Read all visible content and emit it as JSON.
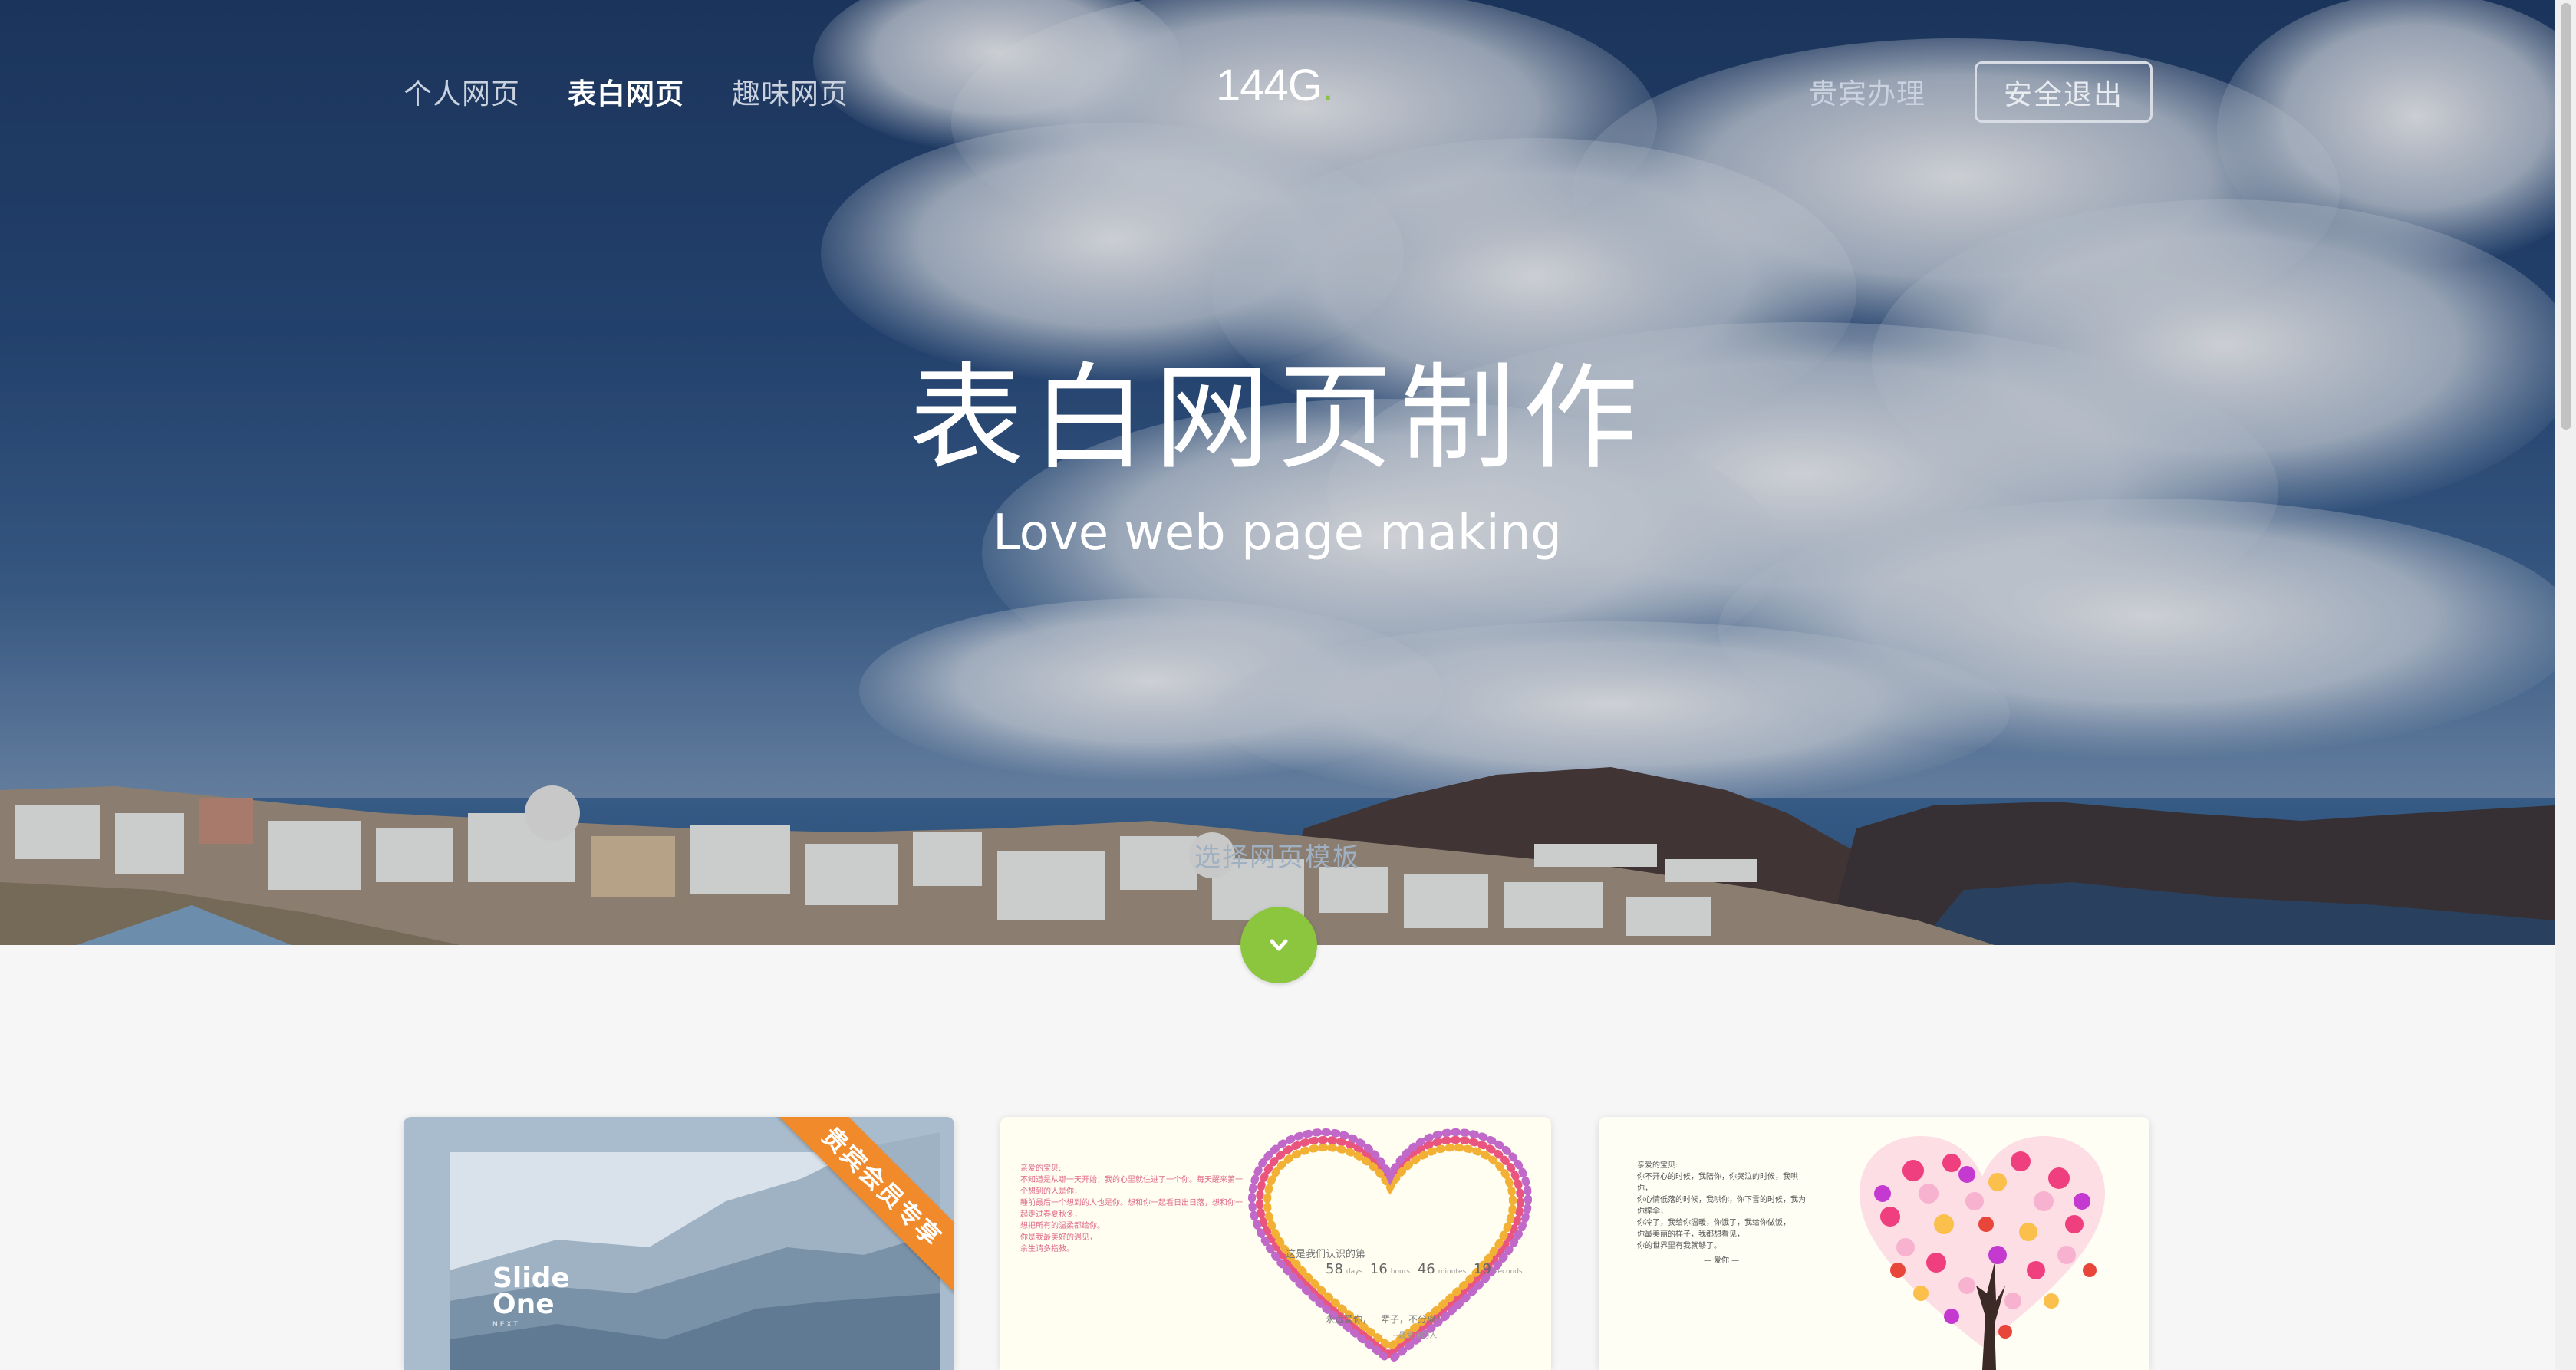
{
  "nav": {
    "left_items": [
      "个人网页",
      "表白网页",
      "趣味网页"
    ],
    "active_index": 1,
    "logo_text": "144G",
    "logo_dot": ".",
    "vip_label": "贵宾办理",
    "logout_label": "安全退出"
  },
  "hero": {
    "title": "表白网页制作",
    "subtitle": "Love web page making",
    "choose_label": "选择网页模板"
  },
  "icons": {
    "down_button": "chevron-down-icon"
  },
  "colors": {
    "accent": "#8cc63f",
    "ribbon": "#f08a2a",
    "nav_active": "#ffffff",
    "nav_inactive": "#c9d2de"
  },
  "cards": [
    {
      "ribbon": "贵宾会员专享",
      "slide_title_line1": "Slide",
      "slide_title_line2": "One",
      "slide_sub": "NEXT"
    },
    {
      "text_lines": [
        "亲爱的宝贝:",
        "不知道是从哪一天开始，我的心里就住进了一个你。每天醒来第一个想到的人是你，",
        "睡前最后一个想到的人也是你。想和你一起看日出日落，想和你一起走过春夏秋冬，",
        "想把所有的温柔都给你。",
        "你是我最美好的遇见，",
        "余生请多指教。"
      ],
      "count_label": "这是我们认识的第",
      "counter_days": "58",
      "counter_hours": "16",
      "counter_minutes": "46",
      "counter_seconds": "19",
      "label_days": "days",
      "label_hours": "hours",
      "label_minutes": "minutes",
      "label_seconds": "seconds",
      "bottom_line": "永远爱你，一辈子，不分离！",
      "signature": "--最爱你的人"
    },
    {
      "text_lines": [
        "亲爱的宝贝:",
        "你不开心的时候，我陪你，你哭泣的时候，我哄你，",
        "你心情低落的时候，我哄你，你下雪的时候，我为你撑伞，",
        "你冷了，我给你温暖，你饿了，我给你做饭，",
        "你最美丽的样子，我都想看见，",
        "你的世界里有我就够了。",
        "— 爱你 —"
      ]
    }
  ]
}
